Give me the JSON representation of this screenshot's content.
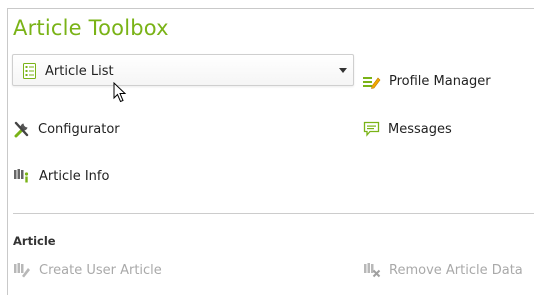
{
  "panel": {
    "title": "Article Toolbox"
  },
  "tools": {
    "dropdown": {
      "label": "Article List",
      "icon": "article-list-icon"
    },
    "profile_manager": {
      "label": "Profile Manager",
      "icon": "profile-manager-icon"
    },
    "configurator": {
      "label": "Configurator",
      "icon": "configurator-icon"
    },
    "messages": {
      "label": "Messages",
      "icon": "messages-icon"
    },
    "article_info": {
      "label": "Article Info",
      "icon": "article-info-icon"
    }
  },
  "article_section": {
    "heading": "Article",
    "actions": [
      {
        "label": "Create User Article",
        "icon": "create-article-icon",
        "enabled": false
      },
      {
        "label": "Remove Article Data",
        "icon": "remove-article-icon",
        "enabled": false
      }
    ]
  },
  "colors": {
    "accent": "#7ab317",
    "disabled": "#a9a9a9"
  }
}
